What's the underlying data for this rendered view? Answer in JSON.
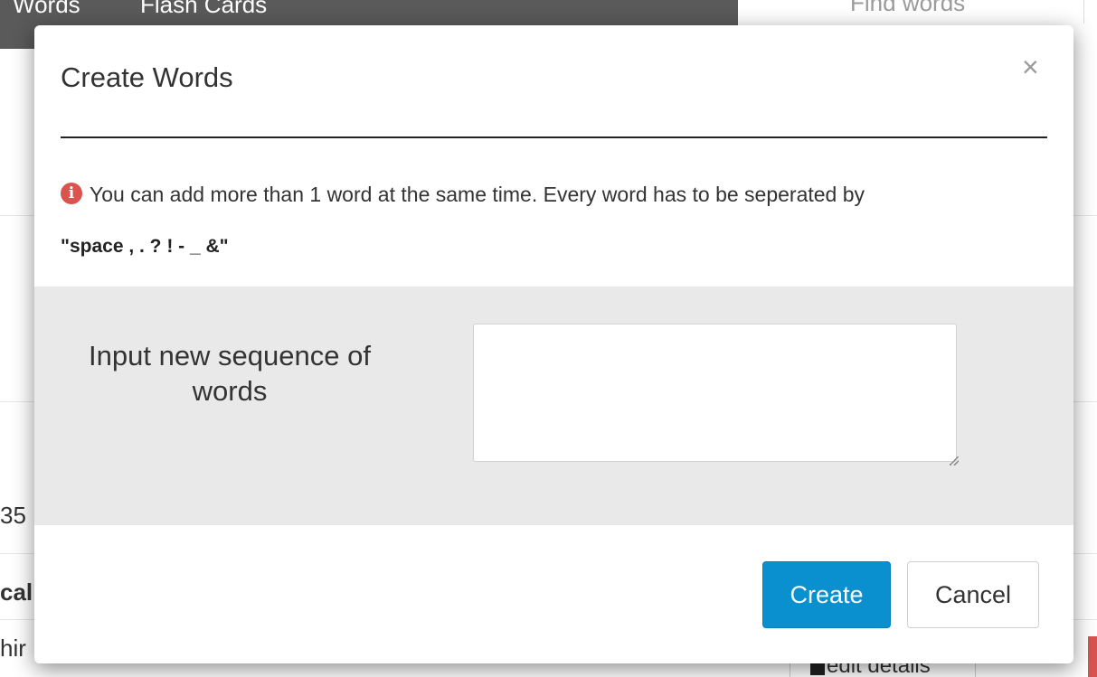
{
  "background": {
    "nav_items": [
      "Words",
      "Flash Cards"
    ],
    "search_placeholder": "Find words",
    "row_fragments": [
      "35",
      "cal",
      "hir"
    ],
    "edit_button_label": "edit details"
  },
  "modal": {
    "title": "Create Words",
    "close_label": "×",
    "info_icon": "info-icon",
    "info_text": "You can add more than 1 word at the same time. Every word has to be seperated by",
    "separators": "\"space , . ? ! - _ &\"",
    "form": {
      "label": "Input new sequence of words",
      "textarea_value": ""
    },
    "buttons": {
      "create": "Create",
      "cancel": "Cancel"
    }
  },
  "colors": {
    "primary": "#0a8fcf",
    "info_icon": "#d9534f",
    "panel_bg": "#e9e9e9",
    "nav_bg": "#5a5a5a"
  }
}
